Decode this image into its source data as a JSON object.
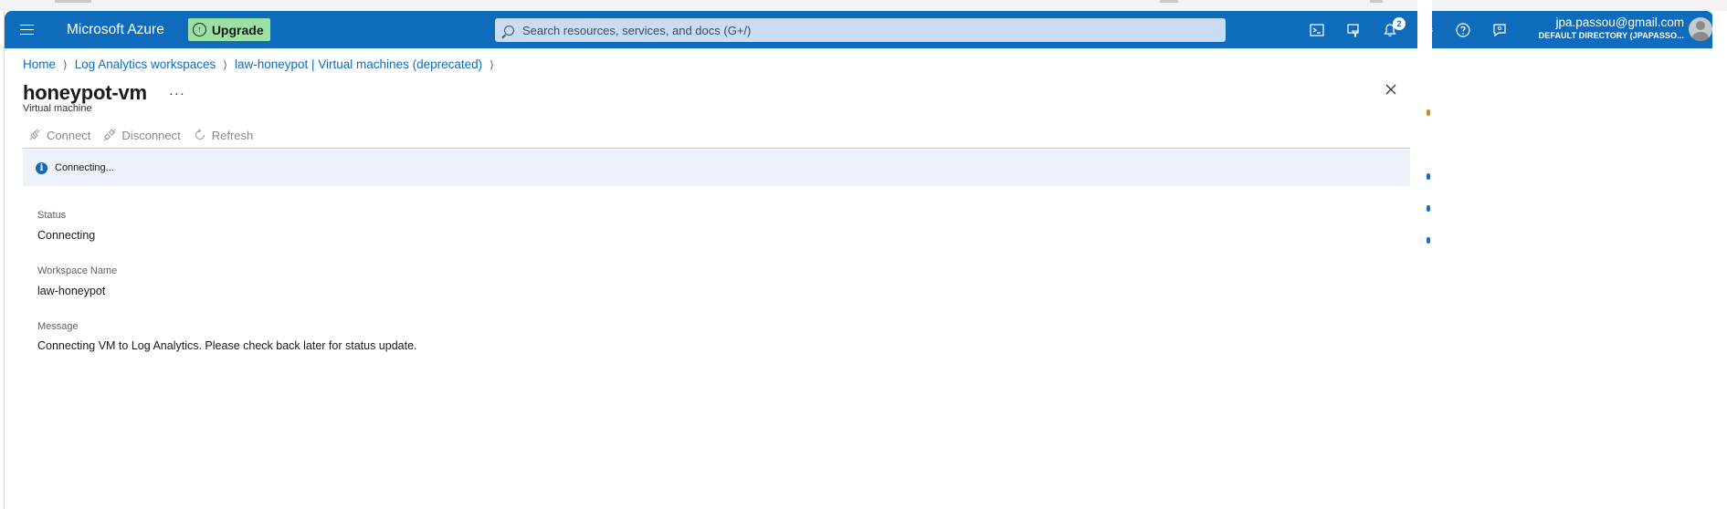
{
  "topbar": {
    "brand": "Microsoft Azure",
    "upgrade_label": "Upgrade",
    "search_placeholder": "Search resources, services, and docs (G+/)",
    "notification_count": "2",
    "account_email": "jpa.passou@gmail.com",
    "account_directory": "DEFAULT DIRECTORY (JPAPASSO..."
  },
  "breadcrumb": {
    "items": [
      "Home",
      "Log Analytics workspaces",
      "law-honeypot | Virtual machines (deprecated)"
    ]
  },
  "page": {
    "title": "honeypot-vm",
    "more": "···",
    "subtitle": "Virtual machine"
  },
  "toolbar": {
    "connect": "Connect",
    "disconnect": "Disconnect",
    "refresh": "Refresh"
  },
  "banner": {
    "text": "Connecting..."
  },
  "details": {
    "status_label": "Status",
    "status_value": "Connecting",
    "workspace_label": "Workspace Name",
    "workspace_value": "law-honeypot",
    "message_label": "Message",
    "message_value": "Connecting VM to Log Analytics. Please check back later for status update."
  },
  "colors": {
    "azure_blue": "#0f6cbd",
    "upgrade_green": "#9ce1a4",
    "banner_bg": "#eef3fb"
  }
}
